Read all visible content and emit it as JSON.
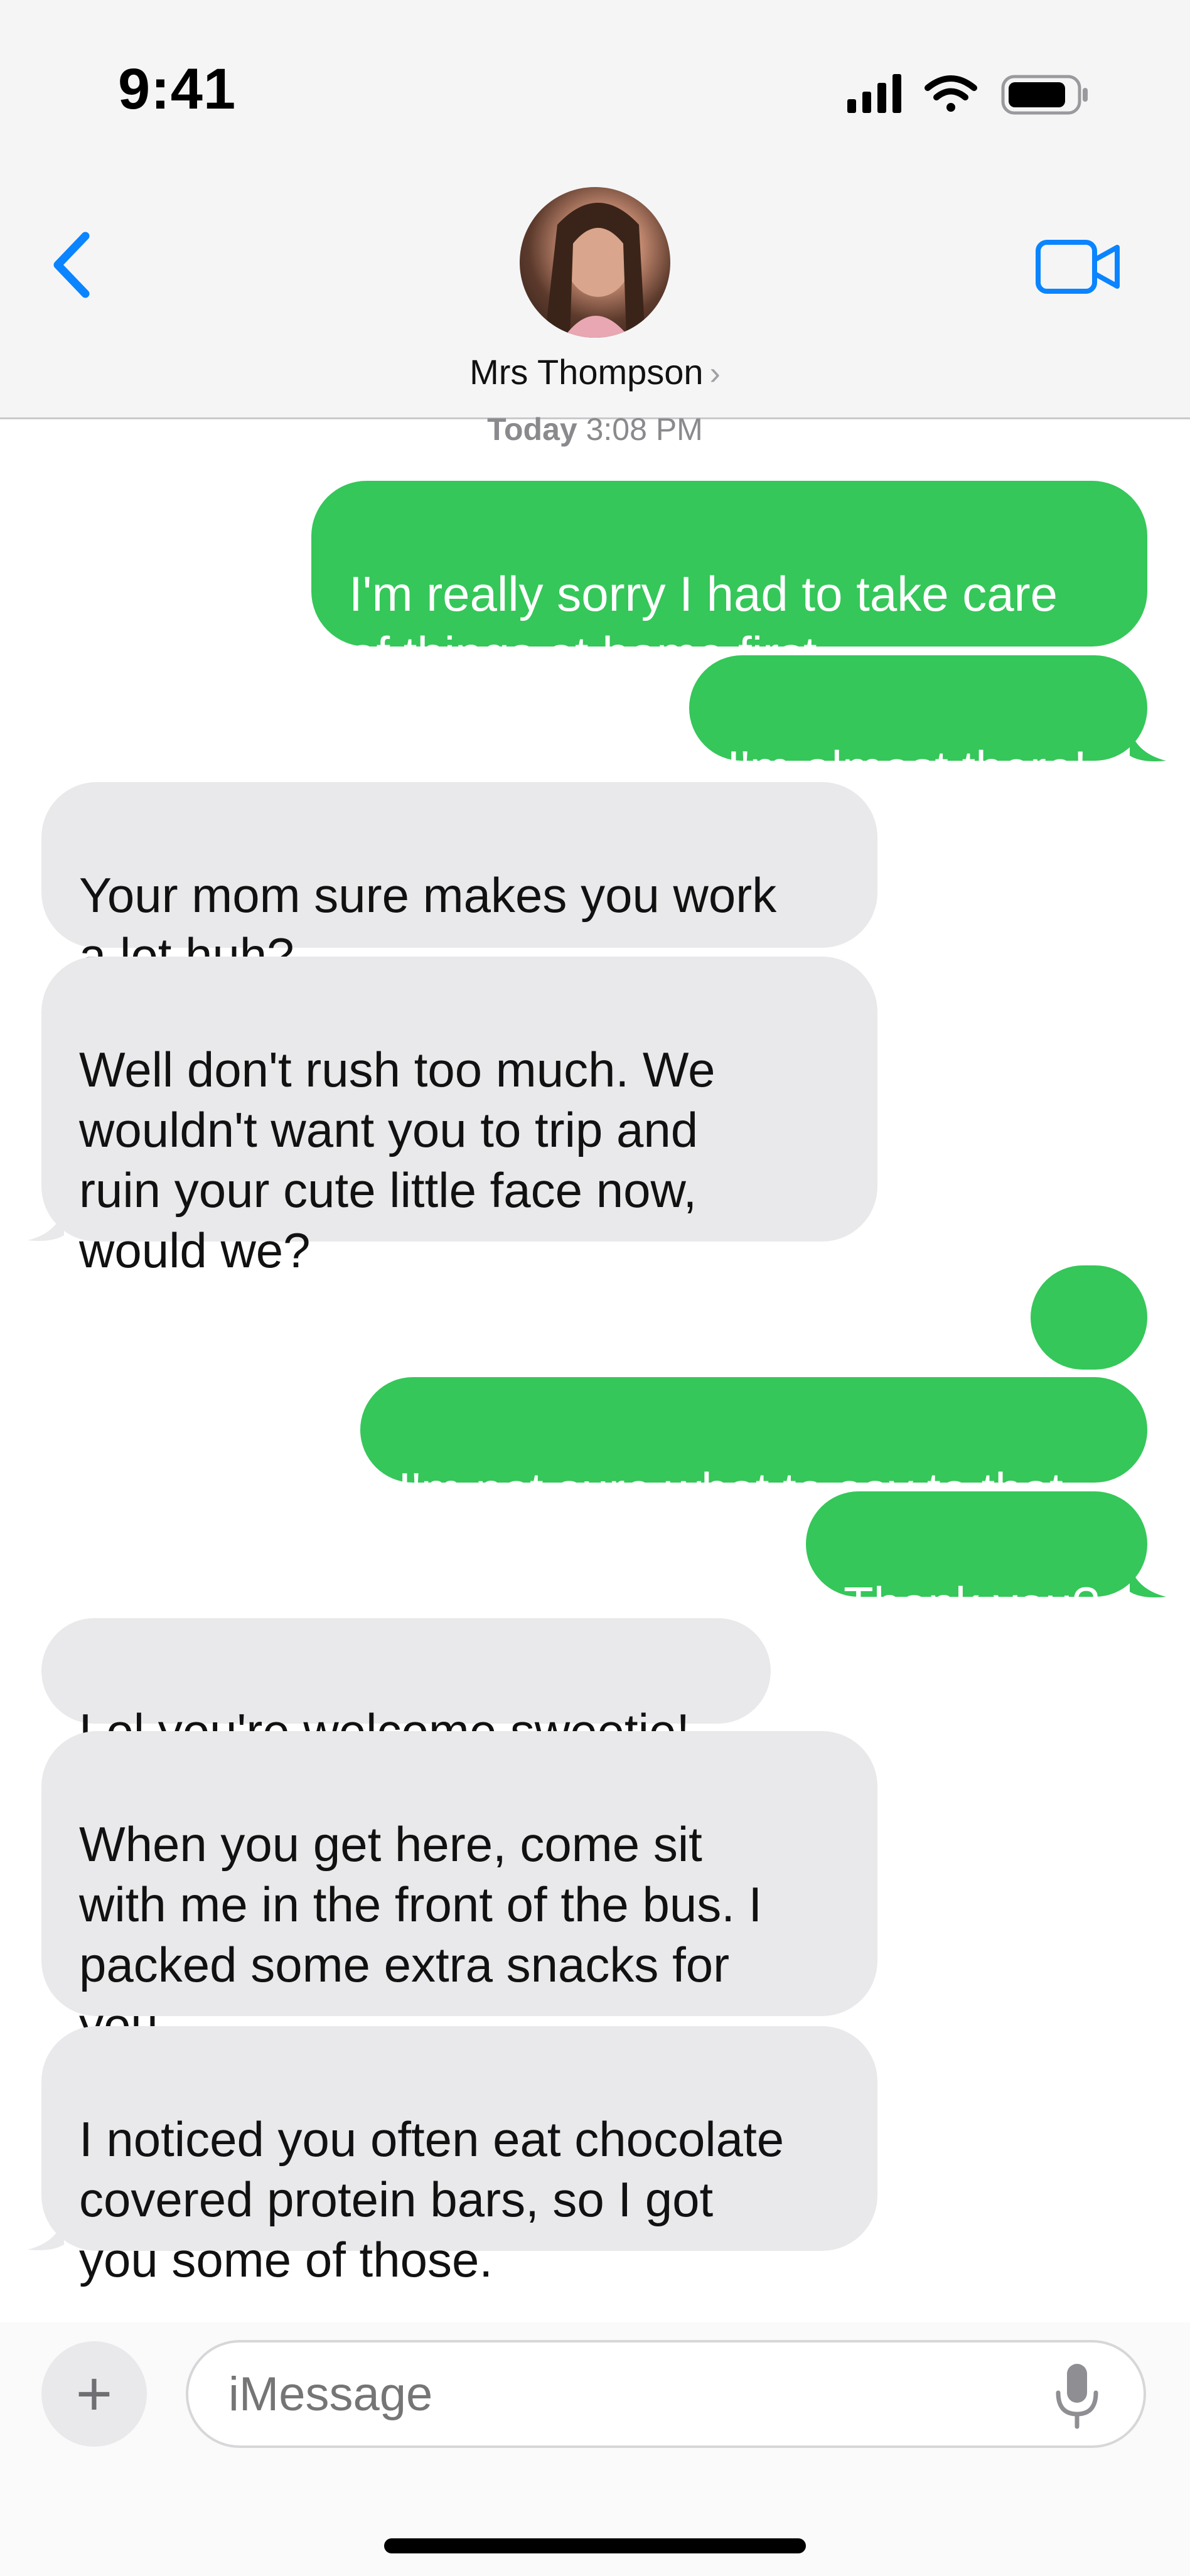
{
  "status_bar": {
    "time": "9:41"
  },
  "header": {
    "contact_name": "Mrs Thompson",
    "chevron": "›",
    "icons": {
      "back": "chevron-left-icon",
      "video": "video-camera-icon"
    }
  },
  "thread": {
    "timestamp_day": "Today",
    "timestamp_time": "3:08 PM",
    "messages": [
      {
        "dir": "out",
        "text": "I'm really sorry I had to take care\nof things at home first"
      },
      {
        "dir": "out",
        "text": "I'm almost there!"
      },
      {
        "dir": "in",
        "text": "Your mom sure makes you work\na lot huh?"
      },
      {
        "dir": "in",
        "text": "Well don't rush too much. We\nwouldn't want you to trip and\nruin your cute little face now,\nwould we?"
      },
      {
        "dir": "out",
        "text": "..."
      },
      {
        "dir": "out",
        "text": "I'm not sure what to say to that"
      },
      {
        "dir": "out",
        "text": "Thank you?"
      },
      {
        "dir": "in",
        "text": "Lol you're welcome sweetie!"
      },
      {
        "dir": "in",
        "text": "When you get here, come sit\nwith me in the front of the bus. I\npacked some extra snacks for\nyou."
      },
      {
        "dir": "in",
        "text": "I noticed you often eat chocolate\ncovered protein bars, so I got\nyou some of those."
      }
    ]
  },
  "compose": {
    "plus_label": "+",
    "placeholder": "iMessage",
    "icons": {
      "add": "plus-icon",
      "mic": "microphone-icon"
    }
  },
  "colors": {
    "outgoing": "#35c759",
    "incoming": "#e9e9eb",
    "accent": "#0a84ff"
  }
}
